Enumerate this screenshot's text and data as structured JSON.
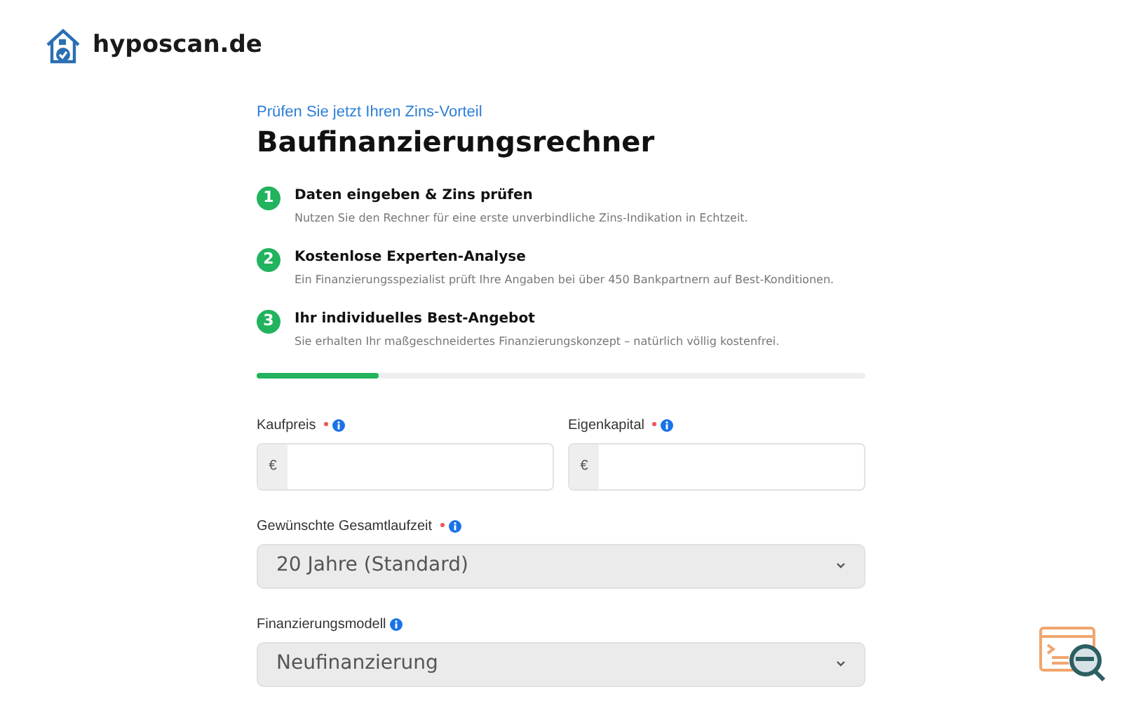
{
  "header": {
    "logo_text": "hyposcan.de"
  },
  "intro": {
    "eyebrow": "Prüfen Sie jetzt Ihren Zins-Vorteil",
    "title": "Baufinanzierungsrechner"
  },
  "steps": [
    {
      "number": "1",
      "title": "Daten eingeben & Zins prüfen",
      "text": "Nutzen Sie den Rechner für eine erste unverbindliche Zins-Indikation in Echtzeit."
    },
    {
      "number": "2",
      "title": "Kostenlose Experten-Analyse",
      "text": "Ein Finanzierungsspezialist prüft Ihre Angaben bei über 450 Bankpartnern auf Best-Konditionen."
    },
    {
      "number": "3",
      "title": "Ihr individuelles Best-Angebot",
      "text": "Sie erhalten Ihr maßgeschneidertes Finanzierungskonzept – natürlich völlig kostenfrei."
    }
  ],
  "progress": {
    "level": 0.2
  },
  "fields": [
    {
      "kind": "money",
      "label": "Kaufpreis",
      "required": true,
      "prefix": "€"
    },
    {
      "kind": "money",
      "label": "Eigenkapital",
      "required": true,
      "prefix": "€"
    },
    {
      "kind": "select",
      "label": "Gewünschte Gesamtlaufzeit",
      "required": true,
      "value": "20 Jahre (Standard)"
    },
    {
      "kind": "select",
      "label": "Finanzierungsmodell",
      "required": false,
      "value": "Neufinanzierung"
    }
  ]
}
